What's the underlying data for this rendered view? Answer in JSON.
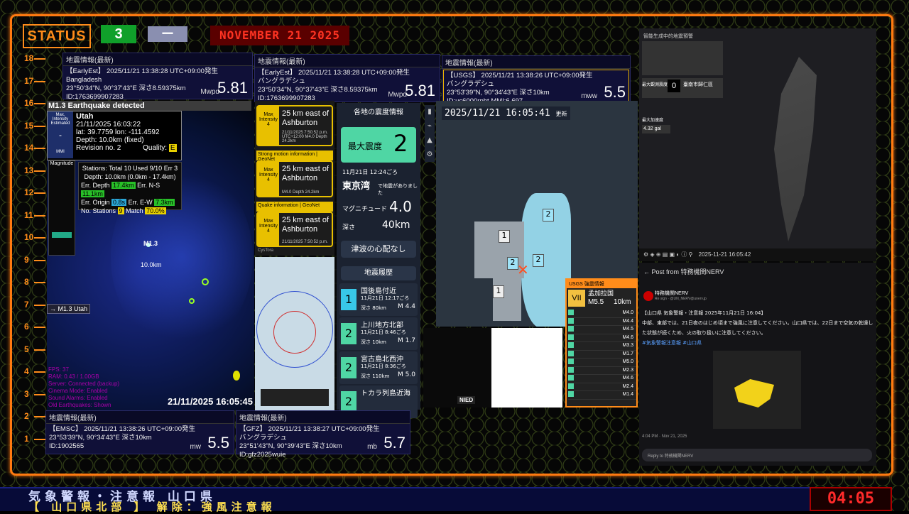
{
  "status": {
    "label": "STATUS",
    "count": "3",
    "dash": "ー",
    "date": "NOVEMBER 21 2025"
  },
  "ruler": [
    "18",
    "17",
    "16",
    "15",
    "14",
    "13",
    "12",
    "11",
    "10",
    "9",
    "8",
    "7",
    "6",
    "5",
    "4",
    "3",
    "2",
    "1"
  ],
  "cards": {
    "ee_small": {
      "header": "地震情報(最新)",
      "l1": "【EarlyEst】 2025/11/21 13:38:28 UTC+09:00発生",
      "l2": "Bangladesh",
      "l3": "23°50'34\"N, 90°37'43\"E 深さ8.59375km",
      "l4": "ID:1763699907283",
      "mt": "Mwpd",
      "mag": "5.81"
    },
    "ee": {
      "header": "地震情報(最新)",
      "l1": "【EarlyEst】 2025/11/21 13:38:28 UTC+09:00発生",
      "l2": "バングラデシュ",
      "l3": "23°50'34\"N, 90°37'43\"E 深さ8.59375km",
      "l4": "ID:1763699907283",
      "mt": "Mwpd",
      "mag": "5.81"
    },
    "usgs": {
      "header": "地震情報(最新)",
      "l1": "【USGS】 2025/11/21 13:38:26 UTC+09:00発生",
      "l2": "バングラデシュ",
      "l3": "23°53'39\"N, 90°34'43\"E 深さ10km",
      "l4": "ID:us6000rpht MMI:6.697",
      "mt": "mww",
      "mag": "5.5"
    },
    "emsc": {
      "header": "地震情報(最新)",
      "l1": "【EMSC】 2025/11/21 13:38:26 UTC+09:00発生",
      "l2": "バングラデシュ",
      "l3": "23°53'39\"N, 90°34'43\"E 深さ10km",
      "l4": "ID:1902565",
      "mt": "mw",
      "mag": "5.5"
    },
    "gfz": {
      "header": "地震情報(最新)",
      "l1": "【GFZ】 2025/11/21 13:38:27 UTC+09:00発生",
      "l2": "バングラデシュ",
      "l3": "23°51'43\"N, 90°39'43\"E 深さ10km",
      "l4": "ID:gfz2025wuie",
      "mt": "mb",
      "mag": "5.7"
    }
  },
  "us": {
    "banner": "M1.3 Earthquake detected",
    "mi_label": "Max. Intensity Estimated",
    "mi_val": "-",
    "mmi": "MMI",
    "place": "Utah",
    "time": "21/11/2025 16:03:22",
    "lat": "lat: 39.7759 lon: -111.4592",
    "depth": "Depth: 10.0km (fixed)",
    "rev": "Revision no. 2",
    "quality": "Quality:",
    "qv": "E",
    "st1": "Stations: Total 10 Used 9/10 Err 3",
    "st2": "Depth: 10.0km (0.0km - 17.4km)",
    "ed": "Err. Depth",
    "edv": "17.4km",
    "ens": "Err. N-S",
    "ensv": "11.1km",
    "eo": "Err. Origin",
    "eov": "0.8s",
    "eew": "Err. E-W",
    "eewv": "7.3km",
    "ns": "No. Stations",
    "nsv": "9",
    "match": "Match",
    "matchv": "70.0%",
    "magnitude": "Magnitude",
    "eq_mark": "M1.3",
    "eq_depth": "10.0km",
    "side_tag": "→ M1.3 Utah",
    "timestamp": "21/11/2025 16:05:45",
    "info1": "FPS: 37",
    "info2": "RAM: 0.43 / 1.00GB",
    "info3": "Server: Connected (backup)",
    "info4": "Cinema Mode: Enabled",
    "info5": "Sound Alarms: Enabled",
    "info6": "Old Earthquakes: Shown"
  },
  "cystora": {
    "c1_t": "25 km east of Ashburton",
    "c1_mi": "Max Intensity 4",
    "c1_s": "21/11/2025 7:50:52 p.m. UTC+12:00  M4.0  Depth 24.2km",
    "c2_h": "Strong motion information | GeoNet",
    "c2_t": "25 km east of Ashburton",
    "c2_s": "M4.0  Depth 24.2km",
    "c3_h": "Quake information | GeoNet",
    "c3_t": "25 km east of Ashburton",
    "c3_s": "21/11/2025 7:50:52 p.m.",
    "foot": "CysTora"
  },
  "shindo": {
    "title": "各地の震度情報",
    "max_lbl": "最大震度",
    "max_val": "2",
    "time": "11月21日 12:24ごろ",
    "place": "東京湾",
    "suffix": "で地震がありました",
    "mag_lbl": "マグニチュード",
    "mag": "4.0",
    "depth_lbl": "深さ",
    "depth": "40km",
    "tsunami": "津波の心配なし",
    "hist_title": "地震履歴",
    "hist": [
      {
        "i": "1",
        "p": "国後島付近",
        "t": "11月21日 12:17ごろ",
        "d": "深さ 80km",
        "m": "M 4.4"
      },
      {
        "i": "2",
        "p": "上川地方北部",
        "t": "11月21日 8:46ごろ",
        "d": "深さ 10km",
        "m": "M 1.7"
      },
      {
        "i": "2",
        "p": "宮古島北西沖",
        "t": "11月21日 8:36ごろ",
        "d": "深さ 110km",
        "m": "M 5.0"
      },
      {
        "i": "2",
        "p": "トカラ列島近海",
        "t": "",
        "d": "",
        "m": ""
      }
    ]
  },
  "jmap": {
    "time": "2025/11/21 16:05:41",
    "upd": "更新",
    "lvl1": "1",
    "lvl2": "2",
    "lvl3": "2",
    "lvl4": "2",
    "lvl5": "1"
  },
  "usgs_side": {
    "title": "USGS 強震情報",
    "int": "VII",
    "place": "孟加拉国",
    "mag": "M5.5",
    "depth": "10km",
    "list": [
      "M4.0",
      "M4.4",
      "M4.5",
      "M4.6",
      "M3.3",
      "M1.7",
      "M5.0",
      "M2.3",
      "M4.6",
      "M2.4",
      "M1.4"
    ]
  },
  "kmap": {
    "logo": "NIED"
  },
  "rpanel": {
    "title": "智能生成中的地震預警",
    "intensity": "0",
    "place": "臺南市歸仁區",
    "time": "2025-11-21 16:05:42",
    "l1": "最大觀測震度",
    "l2": "最大加速度",
    "l2v": "4.32 gal"
  },
  "nerv": {
    "back": "←",
    "title": "Post from 特務機関NERV",
    "user": "特務機関NERV",
    "handle": "Re sign · @UN_NERV@unerv.jp",
    "body1": "【山口県 気象警報・注意報 2025年11月21日 16:04】",
    "body2": "中部、東部では、21日夜のはじめ頃まで強風に注意してください。山口県では、22日まで空気の乾燥した状態が続くため、火の取り扱いに注意してください。",
    "tags": "#気象警報注意報 #山口県",
    "foot": "4:04 PM · Nov 21, 2025",
    "reply": "Reply to 特務機関NERV"
  },
  "ticker": {
    "line1": "気象警報・注意報 山口県",
    "line2": "【 山口県北部 】 解除：強風注意報"
  },
  "clock": "04:05"
}
